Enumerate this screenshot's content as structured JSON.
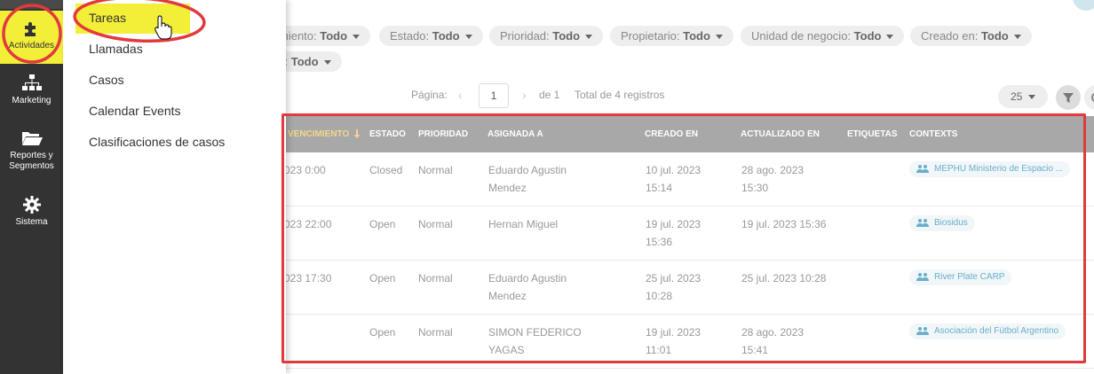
{
  "sidebar": {
    "items": [
      {
        "label": "Actividades",
        "icon": "puzzle-icon"
      },
      {
        "label": "Marketing",
        "icon": "sitemap-icon"
      },
      {
        "label": "Reportes y Segmentos",
        "icon": "folder-icon"
      },
      {
        "label": "Sistema",
        "icon": "gear-icon"
      }
    ]
  },
  "submenu": {
    "items": [
      "Tareas",
      "Llamadas",
      "Casos",
      "Calendar Events",
      "Clasificaciones de casos"
    ]
  },
  "filters": [
    {
      "label": "miento:",
      "value": "Todo"
    },
    {
      "label": "Estado:",
      "value": "Todo"
    },
    {
      "label": "Prioridad:",
      "value": "Todo"
    },
    {
      "label": "Propietario:",
      "value": "Todo"
    },
    {
      "label": "Unidad de negocio:",
      "value": "Todo"
    },
    {
      "label": "Creado en:",
      "value": "Todo"
    },
    {
      "label": "s:",
      "value": "Todo"
    }
  ],
  "pager": {
    "page_label": "Página:",
    "page_value": "1",
    "of_label": "de 1",
    "total_label": "Total de 4 registros",
    "per_page": "25"
  },
  "table": {
    "columns": [
      "VENCIMIENTO",
      "ESTADO",
      "PRIORIDAD",
      "ASIGNADA A",
      "CREADO EN",
      "ACTUALIZADO EN",
      "ETIQUETAS",
      "CONTEXTS"
    ],
    "rows": [
      {
        "due": "023 0:00",
        "status": "Closed",
        "priority": "Normal",
        "assigned_line1": "Eduardo Agustin",
        "assigned_line2": "Mendez",
        "created_line1": "10 jul. 2023",
        "created_line2": "15:14",
        "updated_line1": "28 ago. 2023",
        "updated_line2": "15:30",
        "context": "MEPHU Ministerio de Espacio ..."
      },
      {
        "due": "023 22:00",
        "status": "Open",
        "priority": "Normal",
        "assigned_line1": "Hernan Miguel",
        "assigned_line2": "",
        "created_line1": "19 jul. 2023",
        "created_line2": "15:36",
        "updated_line1": "19 jul. 2023 15:36",
        "updated_line2": "",
        "context": "Biosidus"
      },
      {
        "due": "023 17:30",
        "status": "Open",
        "priority": "Normal",
        "assigned_line1": "Eduardo Agustin",
        "assigned_line2": "Mendez",
        "created_line1": "25 jul. 2023",
        "created_line2": "10:28",
        "updated_line1": "25 jul. 2023 10:28",
        "updated_line2": "",
        "context": "River Plate CARP"
      },
      {
        "due": "",
        "status": "Open",
        "priority": "Normal",
        "assigned_line1": "SIMON FEDERICO",
        "assigned_line2": "YAGAS",
        "created_line1": "19 jul. 2023",
        "created_line2": "11:01",
        "updated_line1": "28 ago. 2023",
        "updated_line2": "15:41",
        "context": "Asociación del Fútbol Argentino"
      }
    ]
  },
  "colors": {
    "sidebar_bg": "#333333",
    "highlight_yellow": "#f3ee38",
    "annotation_red": "#e0393e",
    "table_header_bg": "#a8a8a8",
    "context_text": "#6aaec9"
  }
}
